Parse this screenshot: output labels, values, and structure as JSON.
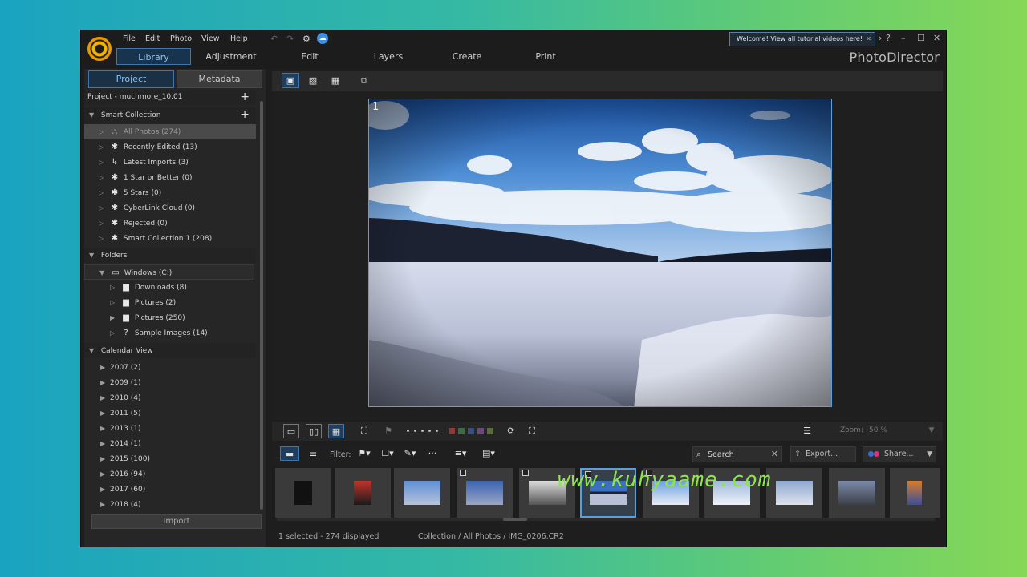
{
  "app": {
    "brand": "PhotoDirector",
    "menu": [
      "File",
      "Edit",
      "Photo",
      "View",
      "Help"
    ],
    "main_tabs": [
      "Library",
      "Adjustment",
      "Edit",
      "Layers",
      "Create",
      "Print"
    ],
    "notification": "Welcome! View all tutorial videos here!"
  },
  "left_panel": {
    "tabs": [
      "Project",
      "Metadata"
    ],
    "project_name": "Project - muchmore_10.01",
    "smart_collection": {
      "title": "Smart Collection",
      "items": [
        "All Photos (274)",
        "Recently Edited (13)",
        "Latest Imports (3)",
        "1 Star or Better (0)",
        "5 Stars (0)",
        "CyberLink Cloud (0)",
        "Rejected (0)",
        "Smart Collection 1 (208)"
      ]
    },
    "folders": {
      "title": "Folders",
      "root": "Windows (C:)",
      "items": [
        "Downloads (8)",
        "Pictures (2)",
        "Pictures (250)",
        "Sample Images (14)"
      ]
    },
    "calendar": {
      "title": "Calendar View",
      "items": [
        "2007 (2)",
        "2009 (1)",
        "2010 (4)",
        "2011 (5)",
        "2013 (1)",
        "2014 (1)",
        "2015 (100)",
        "2016 (94)",
        "2017 (60)",
        "2018 (4)"
      ]
    },
    "import_label": "Import"
  },
  "viewer": {
    "photo_index": "1"
  },
  "toolbar": {
    "zoom_label": "Zoom:",
    "zoom_value": "50 %",
    "color_labels": [
      "#8a3a3a",
      "#3f6a3f",
      "#3a4f7a",
      "#6a4a7a",
      "#5a6a3a"
    ]
  },
  "filter": {
    "label": "Filter:",
    "search_placeholder": "Search",
    "export_label": "Export...",
    "share_label": "Share..."
  },
  "status": {
    "selection": "1 selected - 274 displayed",
    "path": "Collection / All Photos / IMG_0206.CR2"
  },
  "watermark": "www.kuhyaame.com"
}
